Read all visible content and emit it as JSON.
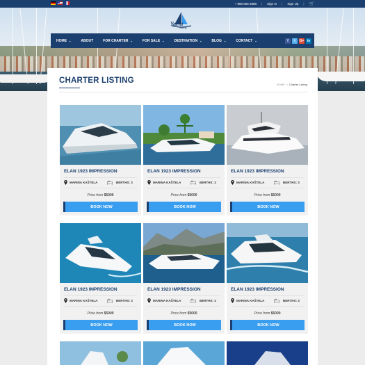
{
  "topbar": {
    "flags": [
      "de-flag",
      "us-flag",
      "fr-flag"
    ],
    "phone": "+ 888 555 8888",
    "sign_in": "Sign In",
    "sign_up": "Sign Up",
    "sep1": "|",
    "sep2": "|",
    "sep3": "|"
  },
  "brand": {
    "logo_text": "Yacht",
    "logo_sub": "Sailing"
  },
  "nav": {
    "items": [
      {
        "label": "HOME",
        "dropdown": true
      },
      {
        "label": "ABOUT",
        "dropdown": false
      },
      {
        "label": "FOR CHARTER",
        "dropdown": true
      },
      {
        "label": "FOR SALE",
        "dropdown": true
      },
      {
        "label": "DESTINATION",
        "dropdown": true
      },
      {
        "label": "BLOG",
        "dropdown": true
      },
      {
        "label": "CONTACT",
        "dropdown": true
      }
    ],
    "chevron": "⌄",
    "socials": [
      "f",
      "t",
      "G+",
      "in"
    ]
  },
  "page": {
    "title": "CHARTER LISTING",
    "breadcrumb": {
      "home": "HOME",
      "sep": "»",
      "current": "Charter Listing"
    }
  },
  "cards": [
    {
      "title": "ELAN 1923 IMPRESSION",
      "location": "MARINA KAŠTELA",
      "berths": "BERTHS: 3",
      "price_label": "Price from",
      "price": "$5000",
      "button": "BOOK NOW"
    },
    {
      "title": "ELAN 1923 IMPRESSION",
      "location": "MARINA KAŠTELA",
      "berths": "BERTHS: 3",
      "price_label": "Price from",
      "price": "$5000",
      "button": "BOOK NOW"
    },
    {
      "title": "ELAN 1923 IMPRESSION",
      "location": "MARINA KAŠTELA",
      "berths": "BERTHS: 3",
      "price_label": "Price from",
      "price": "$5000",
      "button": "BOOK NOW"
    },
    {
      "title": "ELAN 1923 IMPRESSION",
      "location": "MARINA KAŠTELA",
      "berths": "BERTHS: 3",
      "price_label": "Price from",
      "price": "$5000",
      "button": "BOOK NOW"
    },
    {
      "title": "ELAN 1923 IMPRESSION",
      "location": "MARINA KAŠTELA",
      "berths": "BERTHS: 3",
      "price_label": "Price from",
      "price": "$5000",
      "button": "BOOK NOW"
    },
    {
      "title": "ELAN 1923 IMPRESSION",
      "location": "MARINA KAŠTELA",
      "berths": "BERTHS: 3",
      "price_label": "Price from",
      "price": "$5000",
      "button": "BOOK NOW"
    }
  ],
  "colors": {
    "navy": "#1b3f6e",
    "button_blue": "#3a9ef0",
    "card_bg": "#f1f1f1"
  }
}
